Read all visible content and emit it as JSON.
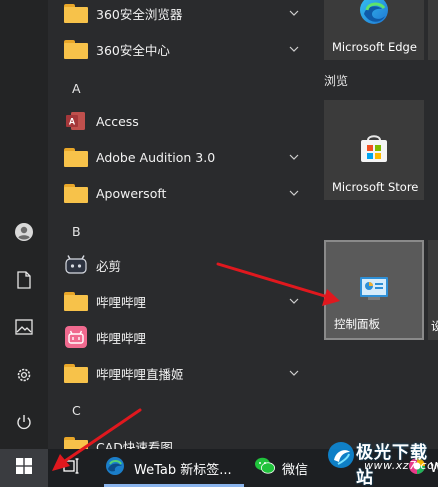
{
  "app_list": {
    "items": [
      {
        "type": "folder",
        "label": "360安全浏览器",
        "icon": "folder-icon",
        "expandable": true
      },
      {
        "type": "folder",
        "label": "360安全中心",
        "icon": "folder-icon",
        "expandable": true
      },
      {
        "type": "letter",
        "label": "A"
      },
      {
        "type": "app",
        "label": "Access",
        "icon": "access-icon"
      },
      {
        "type": "folder",
        "label": "Adobe Audition 3.0",
        "icon": "folder-icon",
        "expandable": true
      },
      {
        "type": "folder",
        "label": "Apowersoft",
        "icon": "folder-icon",
        "expandable": true
      },
      {
        "type": "letter",
        "label": "B"
      },
      {
        "type": "app",
        "label": "必剪",
        "icon": "bijian-icon"
      },
      {
        "type": "folder",
        "label": "哔哩哔哩",
        "icon": "folder-icon",
        "expandable": true
      },
      {
        "type": "app",
        "label": "哔哩哔哩",
        "icon": "bilibili-icon"
      },
      {
        "type": "folder",
        "label": "哔哩哔哩直播姬",
        "icon": "folder-icon",
        "expandable": true
      },
      {
        "type": "letter",
        "label": "C"
      },
      {
        "type": "folder",
        "label": "CAD快速看图",
        "icon": "folder-icon",
        "expandable": true
      }
    ]
  },
  "tiles": {
    "group_label": "浏览",
    "edge": {
      "label": "Microsoft Edge",
      "icon": "edge-icon"
    },
    "store": {
      "label": "Microsoft Store",
      "icon": "store-icon"
    },
    "control_panel": {
      "label": "控制面板",
      "icon": "control-panel-icon"
    },
    "partial": {
      "label": "设"
    }
  },
  "left_rail": {
    "user": "user-icon",
    "documents": "document-icon",
    "pictures": "pictures-icon",
    "settings": "gear-icon",
    "power": "power-icon"
  },
  "taskbar": {
    "start": "windows-logo-icon",
    "task_view": "task-view-icon",
    "wetab_label": "WeTab 新标签...",
    "wechat_label": "微信",
    "partial_label": "W"
  },
  "watermark": {
    "title": "极光下载站",
    "url": "www.xz7.com"
  },
  "colors": {
    "accent_arrow": "#e0181e",
    "menu_bg": "#2a2b2d",
    "tile_bg": "#3b3b3b",
    "folder": "#f7c24a"
  }
}
